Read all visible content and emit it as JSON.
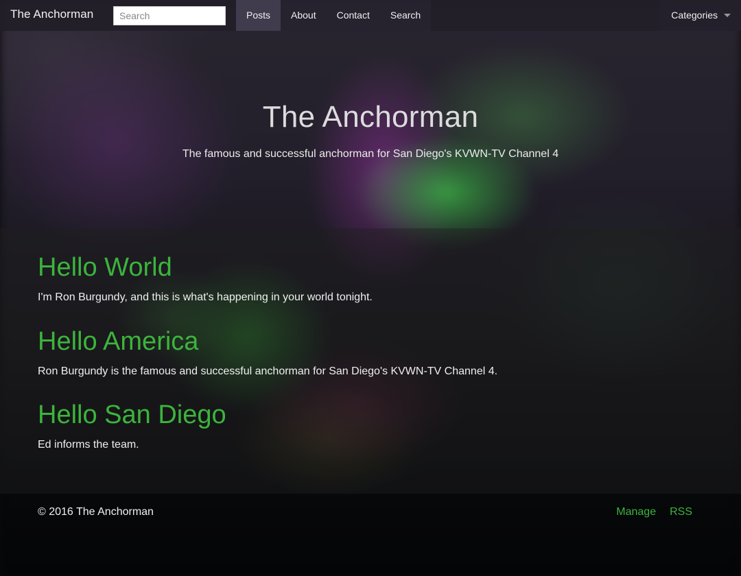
{
  "navbar": {
    "brand": "The Anchorman",
    "search_placeholder": "Search",
    "links": [
      {
        "label": "Posts",
        "active": true
      },
      {
        "label": "About",
        "active": false
      },
      {
        "label": "Contact",
        "active": false
      },
      {
        "label": "Search",
        "active": false
      }
    ],
    "categories_label": "Categories"
  },
  "hero": {
    "title": "The Anchorman",
    "subtitle": "The famous and successful anchorman for San Diego's KVWN-TV Channel 4"
  },
  "posts": [
    {
      "title": "Hello World",
      "excerpt": "I'm Ron Burgundy, and this is what's happening in your world tonight."
    },
    {
      "title": "Hello America",
      "excerpt": "Ron Burgundy is the famous and successful anchorman for San Diego's KVWN-TV Channel 4."
    },
    {
      "title": "Hello San Diego",
      "excerpt": "Ed informs the team."
    }
  ],
  "footer": {
    "copyright": "© 2016 The Anchorman",
    "links": [
      "Manage",
      "RSS"
    ]
  },
  "colors": {
    "accent": "#3cb43c",
    "navbar_bg": "#221e28",
    "text": "#efefef"
  }
}
